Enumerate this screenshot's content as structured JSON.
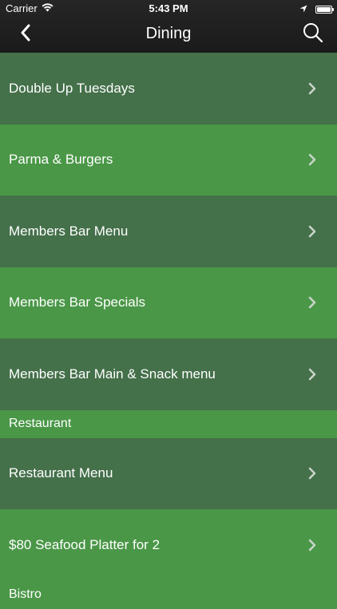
{
  "status_bar": {
    "carrier": "Carrier",
    "time": "5:43 PM",
    "battery_level": 1.0
  },
  "navbar": {
    "title": "Dining",
    "back_icon": "chevron-left-icon",
    "search_icon": "search-icon"
  },
  "list": {
    "group1": [
      {
        "label": "Double Up Tuesdays"
      },
      {
        "label": "Parma & Burgers"
      },
      {
        "label": "Members Bar Menu"
      },
      {
        "label": "Members Bar Specials"
      },
      {
        "label": "Members Bar Main & Snack menu"
      }
    ],
    "section_restaurant": "Restaurant",
    "group2": [
      {
        "label": "Restaurant Menu"
      },
      {
        "label": "$80 Seafood Platter for 2"
      }
    ],
    "section_bistro": "Bistro"
  },
  "colors": {
    "row_dark": "#44704a",
    "row_light": "#4a9747",
    "navbar": "#1f1f1f",
    "text": "#ffffff",
    "chevron": "#c8d4c8"
  }
}
